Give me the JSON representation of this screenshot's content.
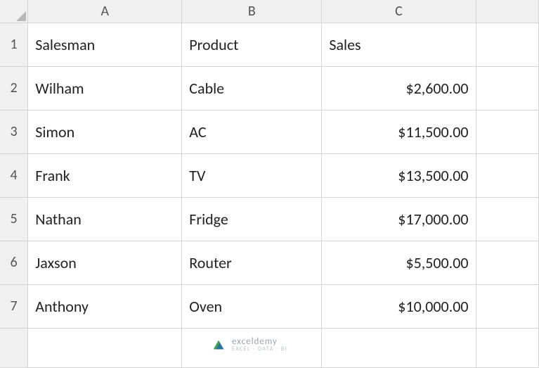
{
  "columns": [
    "A",
    "B",
    "C"
  ],
  "row_labels": [
    "1",
    "2",
    "3",
    "4",
    "5",
    "6",
    "7"
  ],
  "headers": {
    "a": "Salesman",
    "b": "Product",
    "c": "Sales"
  },
  "rows": [
    {
      "a": "Wilham",
      "b": "Cable",
      "c": "$2,600.00"
    },
    {
      "a": "Simon",
      "b": "AC",
      "c": "$11,500.00"
    },
    {
      "a": "Frank",
      "b": "TV",
      "c": "$13,500.00"
    },
    {
      "a": "Nathan",
      "b": "Fridge",
      "c": "$17,000.00"
    },
    {
      "a": "Jaxson",
      "b": "Router",
      "c": "$5,500.00"
    },
    {
      "a": "Anthony",
      "b": "Oven",
      "c": "$10,000.00"
    }
  ],
  "watermark": {
    "brand": "exceldemy",
    "tagline": "EXCEL · DATA · BI"
  }
}
